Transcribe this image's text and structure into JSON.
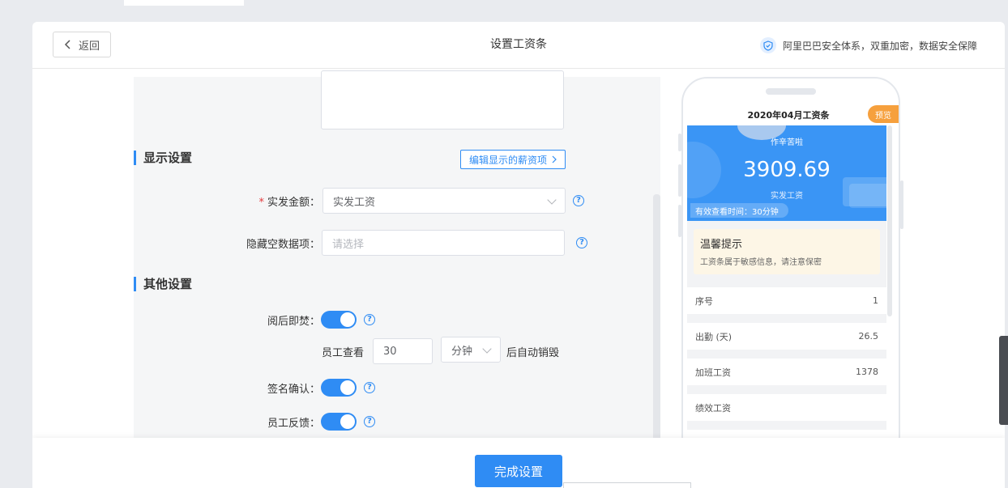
{
  "header": {
    "back_label": "返回",
    "title": "设置工资条",
    "security_text": "阿里巴巴安全体系，双重加密，数据安全保障"
  },
  "display_section": {
    "title": "显示设置",
    "edit_link": "编辑显示的薪资项",
    "amount_label": "实发金额：",
    "amount_value": "实发工资",
    "hide_empty_label": "隐藏空数据项：",
    "hide_empty_placeholder": "请选择"
  },
  "other_section": {
    "title": "其他设置",
    "burn_label": "阅后即焚：",
    "burn_enabled": true,
    "burn_prefix": "员工查看",
    "burn_value": "30",
    "burn_unit": "分钟",
    "burn_suffix": "后自动销毁",
    "signature_label": "签名确认：",
    "signature_enabled": true,
    "feedback_label": "员工反馈：",
    "feedback_enabled": true
  },
  "footer": {
    "done_label": "完成设置"
  },
  "preview": {
    "title": "2020年04月工资条",
    "badge": "预览",
    "greeting": "作辛苦啦",
    "amount": "3909.69",
    "amount_label": "实发工资",
    "valid_time": "有效查看时间：30分钟",
    "tip_title": "温馨提示",
    "tip_text": "工资条属于敏感信息，请注意保密",
    "rows": [
      {
        "label": "序号",
        "value": "1"
      },
      {
        "label": "出勤 (天)",
        "value": "26.5"
      },
      {
        "label": "加班工资",
        "value": "1378"
      },
      {
        "label": "绩效工资",
        "value": ""
      }
    ]
  },
  "colors": {
    "accent": "#2f8cf4",
    "badge": "#f6a03d",
    "tip_bg": "#fdf6e6"
  }
}
